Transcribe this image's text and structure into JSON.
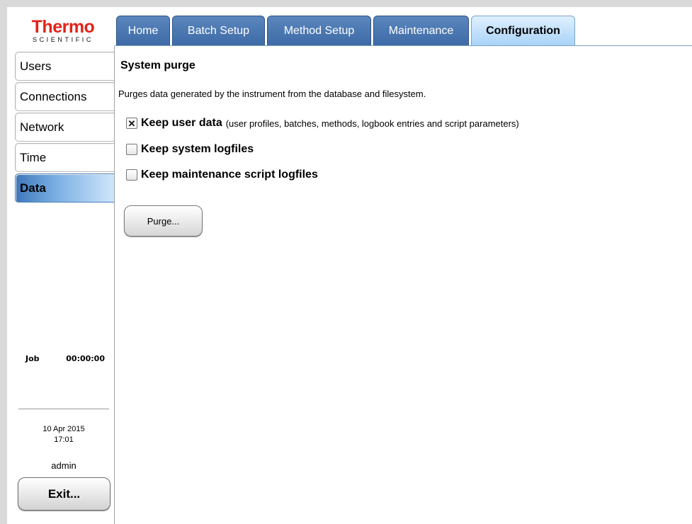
{
  "logo": {
    "word": "Thermo",
    "sub": "SCIENTIFIC"
  },
  "tabs": [
    {
      "label": "Home",
      "active": false
    },
    {
      "label": "Batch Setup",
      "active": false
    },
    {
      "label": "Method Setup",
      "active": false
    },
    {
      "label": "Maintenance",
      "active": false
    },
    {
      "label": "Configuration",
      "active": true
    }
  ],
  "sidebar": {
    "items": [
      {
        "label": "Users",
        "active": false
      },
      {
        "label": "Connections",
        "active": false
      },
      {
        "label": "Network",
        "active": false
      },
      {
        "label": "Time",
        "active": false
      },
      {
        "label": "Data",
        "active": true
      }
    ],
    "job_label": "Job",
    "job_time": "00:00:00",
    "date": "10 Apr 2015",
    "time": "17:01",
    "user": "admin",
    "exit_label": "Exit..."
  },
  "main": {
    "title": "System purge",
    "description": "Purges data generated by the instrument from the database and filesystem.",
    "options": [
      {
        "label": "Keep user data",
        "hint": "(user profiles, batches, methods, logbook entries and script parameters)",
        "checked": true
      },
      {
        "label": "Keep system logfiles",
        "hint": "",
        "checked": false
      },
      {
        "label": "Keep maintenance script logfiles",
        "hint": "",
        "checked": false
      }
    ],
    "checkbox_checked_glyph": "✕",
    "purge_label": "Purge..."
  },
  "colors": {
    "tab_blue": "#3d6aa6",
    "tab_active": "#a8d2f7",
    "logo_red": "#e2231a",
    "nav_active": "#3e77ba"
  }
}
